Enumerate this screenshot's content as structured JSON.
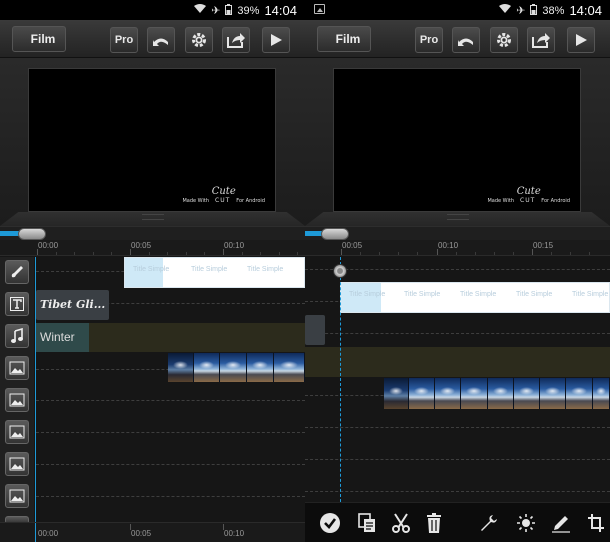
{
  "status_left": {
    "battery": "39%",
    "time": "14:04"
  },
  "status_right": {
    "battery": "38%",
    "time": "14:04"
  },
  "toolbar": {
    "back_label": "Film",
    "pro_label": "Pro",
    "icons": [
      "undo-icon",
      "gear-icon",
      "share-icon",
      "play-icon"
    ]
  },
  "watermark": {
    "cute": "Cute",
    "made_with": "Made With",
    "cut": "CUT",
    "for_android": "For Android"
  },
  "ruler_left": [
    "00:00",
    "00:05",
    "00:10"
  ],
  "ruler_left_bottom": [
    "00:00",
    "00:05",
    "00:10"
  ],
  "ruler_right": [
    "00:05",
    "00:10",
    "00:15"
  ],
  "track_buttons": [
    "brush-icon",
    "text-icon",
    "music-icon",
    "image-icon",
    "image-icon",
    "image-icon",
    "image-icon",
    "image-icon"
  ],
  "clips_left": {
    "title_text": [
      "Title Simple",
      "Title Simple",
      "Title Simple"
    ],
    "text_label": "Tibet Gli...",
    "music_label": "Winter"
  },
  "clips_right": {
    "title_text": [
      "Title Simple",
      "Title Simple",
      "Title Simple",
      "Title Simple",
      "Title Simple"
    ]
  },
  "actions": [
    "check-icon",
    "copy-icon",
    "cut-icon",
    "delete-icon",
    "wrench-icon",
    "brightness-icon",
    "pen-icon",
    "crop-icon"
  ],
  "colors": {
    "accent": "#1e9ad8",
    "music_clip": "#2c2b1c",
    "text_clip": "#3a3f44"
  }
}
